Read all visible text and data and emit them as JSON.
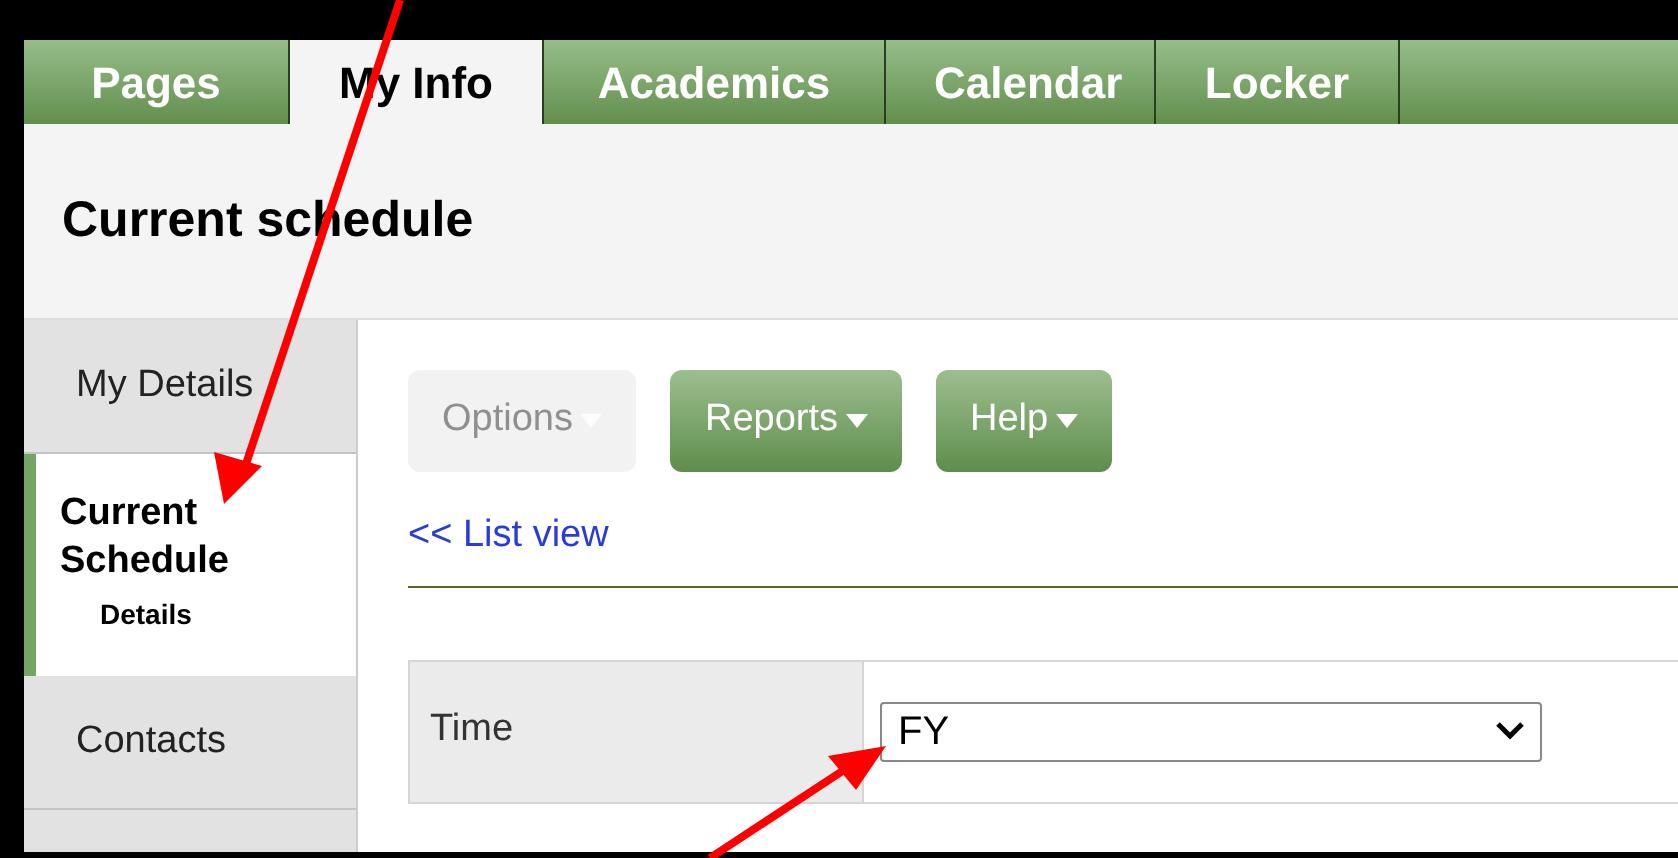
{
  "tabs": [
    {
      "label": "Pages",
      "selected": false
    },
    {
      "label": "My Info",
      "selected": true
    },
    {
      "label": "Academics",
      "selected": false
    },
    {
      "label": "Calendar",
      "selected": false
    },
    {
      "label": "Locker",
      "selected": false
    }
  ],
  "page_title": "Current schedule",
  "sidebar": {
    "items": [
      {
        "label": "My Details",
        "selected": false
      },
      {
        "label": "Current Schedule",
        "sub_label": "Details",
        "selected": true
      },
      {
        "label": "Contacts",
        "selected": false
      }
    ]
  },
  "toolbar": [
    {
      "label": "Options",
      "disabled": true
    },
    {
      "label": "Reports",
      "disabled": false
    },
    {
      "label": "Help",
      "disabled": false
    }
  ],
  "back_link": "<< List view",
  "filter": {
    "label": "Time",
    "value": "FY"
  }
}
